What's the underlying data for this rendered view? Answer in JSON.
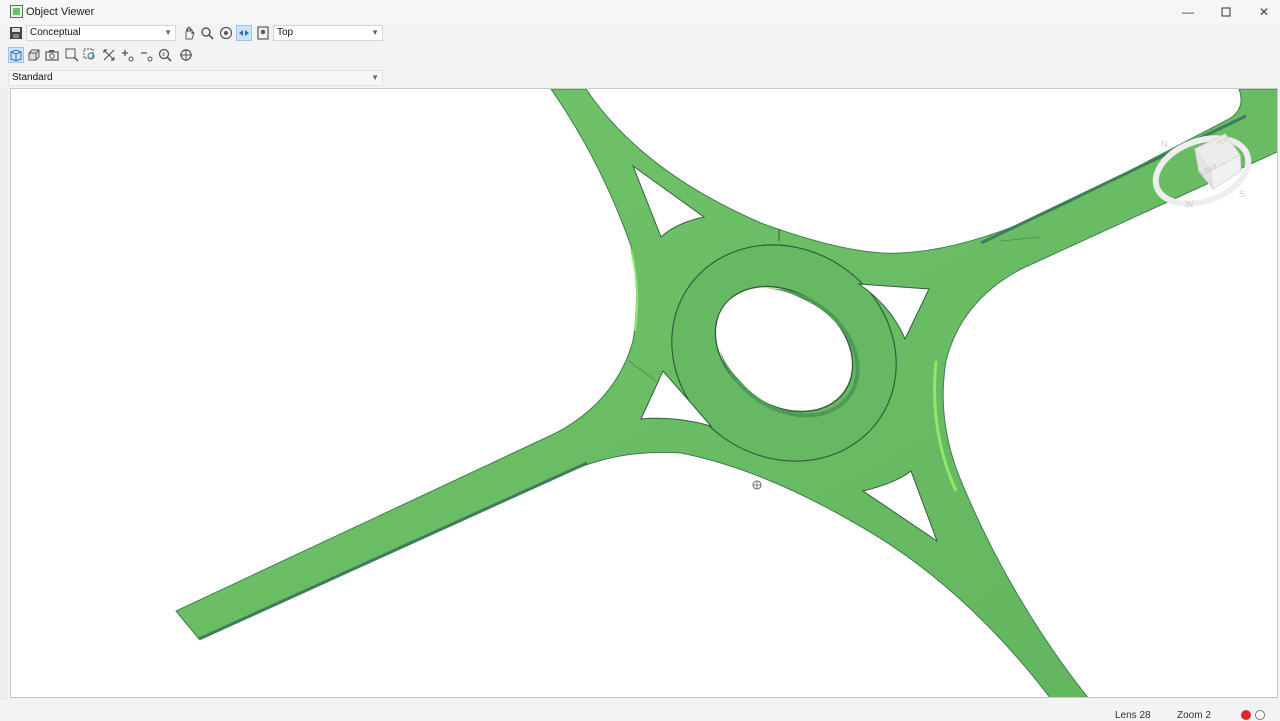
{
  "window": {
    "title": "Object Viewer",
    "minimize_icon": "minimize-icon",
    "maximize_icon": "maximize-icon",
    "close_icon": "close-icon"
  },
  "toolbar1": {
    "visual_style": "Conceptual",
    "view": "Top",
    "icons": [
      "save-icon",
      "pan-icon",
      "zoom-icon",
      "orbit-icon",
      "free-orbit-icon",
      "walk-icon"
    ]
  },
  "toolbar2": {
    "icons": [
      "view-3d-icon",
      "view-box-icon",
      "camera-icon",
      "zoom-window-icon",
      "zoom-selected-icon",
      "zoom-extents-icon",
      "zoom-in-icon",
      "zoom-out-icon",
      "zoom-realtime-icon",
      "target-icon"
    ]
  },
  "display_dropdown": "Standard",
  "viewcube": {
    "face": "LEFT",
    "top_label": "TOP",
    "compass": [
      "N",
      "W",
      "S"
    ]
  },
  "status": {
    "lens": "Lens 28",
    "zoom": "Zoom 2"
  },
  "colors": {
    "road": "#6bbf66",
    "road_edge": "#3f7d4f",
    "road_highlight": "#8fe86a",
    "background": "#ffffff"
  }
}
